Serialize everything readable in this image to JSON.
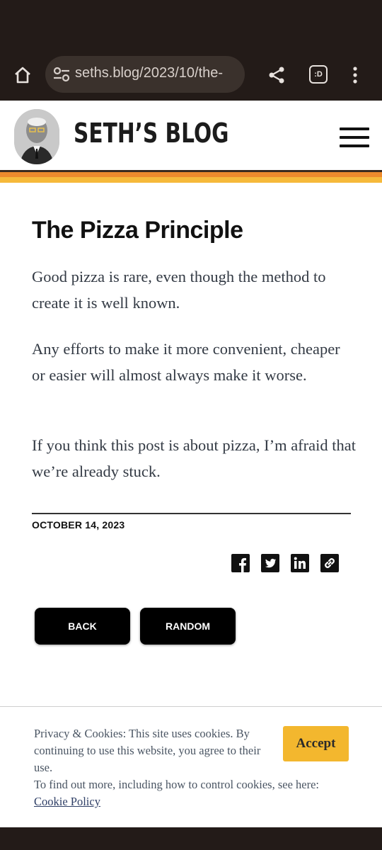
{
  "browser": {
    "url": "seths.blog/2023/10/the-",
    "tabs_label": ":D",
    "icons": {
      "home": "home-icon",
      "site_info": "tune-icon",
      "share": "share-icon",
      "menu": "more-vert-icon"
    }
  },
  "header": {
    "logo": "SETH’S BLOG"
  },
  "post": {
    "title": "The Pizza Principle",
    "paragraphs": [
      "Good pizza is rare, even though the method to create it is well known.",
      "Any efforts to make it more convenient, cheaper or easier will almost always make it worse.",
      "If you think this post is about pizza, I’m afraid that we’re already stuck."
    ],
    "date": "OCTOBER 14, 2023"
  },
  "share": {
    "icons": [
      "facebook-icon",
      "twitter-icon",
      "linkedin-icon",
      "link-icon"
    ]
  },
  "nav": {
    "back_label": "BACK",
    "random_label": "RANDOM"
  },
  "cookie": {
    "text": "Privacy & Cookies: This site uses cookies. By continuing to use this website, you agree to their use.",
    "more": "To find out more, including how to control cookies, see here:",
    "link": "Cookie Policy",
    "accept_label": "Accept"
  },
  "colors": {
    "browser_bg": "#231b18",
    "stripe_dark": "#3a2a20",
    "stripe_orange": "#ee8a2d",
    "stripe_yellow": "#f6b93b",
    "accept_bg": "#f3b72e"
  }
}
